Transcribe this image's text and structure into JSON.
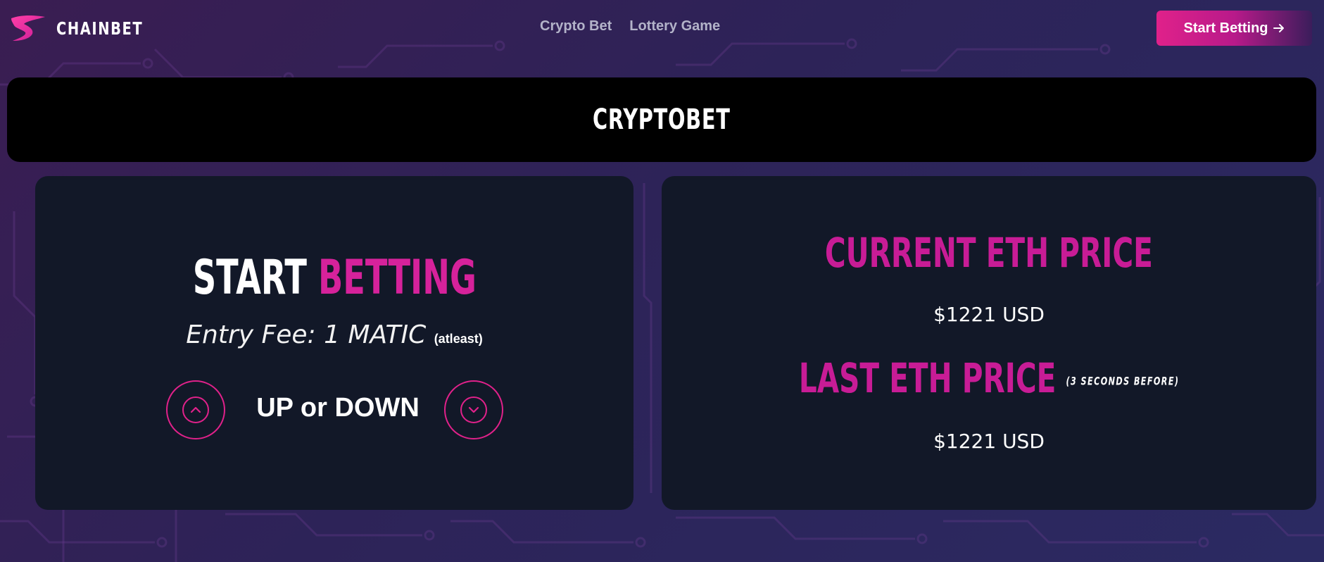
{
  "header": {
    "brand": "CHAINBET",
    "nav": [
      {
        "label": "Crypto Bet"
      },
      {
        "label": "Lottery Game"
      }
    ],
    "cta_label": "Start Betting",
    "cta_icon": "arrow-right-icon"
  },
  "page_title": "CRYPTOBET",
  "betting": {
    "heading_white": "START",
    "heading_pink": "BETTING",
    "entry_fee": "Entry Fee: 1 MATIC",
    "entry_fee_note": "(atleast)",
    "choice_label": "UP or DOWN",
    "up_icon": "chevron-up-icon",
    "down_icon": "chevron-down-icon"
  },
  "prices": {
    "current_heading": "CURRENT ETH PRICE",
    "current_value": "$1221 USD",
    "last_heading": "LAST ETH PRICE",
    "last_note": "(3 SECONDS BEFORE)",
    "last_value": "$1221 USD"
  },
  "colors": {
    "accent": "#d6229b",
    "panel_bg": "#121828",
    "title_bar_bg": "#000000"
  }
}
